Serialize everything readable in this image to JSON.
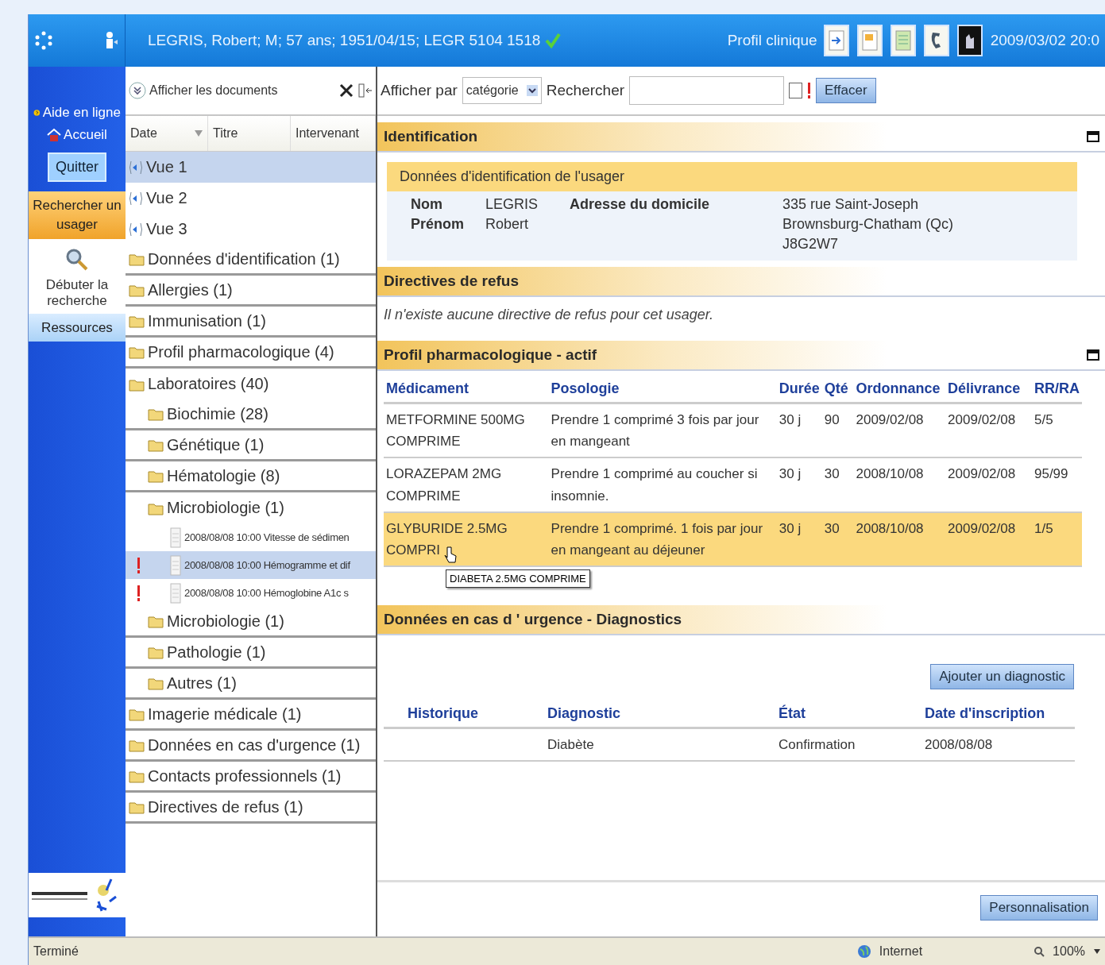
{
  "header": {
    "patient": "LEGRIS, Robert; M; 57 ans; 1951/04/15; LEGR 5104 1518",
    "verified": true,
    "profile_label": "Profil clinique",
    "datetime": "2009/03/02 20:0"
  },
  "nav": {
    "items": [
      {
        "label": "Aide en ligne",
        "kind": "help"
      },
      {
        "label": "Accueil",
        "kind": "home"
      },
      {
        "label": "Quitter",
        "kind": "button"
      },
      {
        "label": "Rechercher un usager",
        "kind": "tab",
        "selected": true
      },
      {
        "label": "Débuter la recherche",
        "kind": "action"
      },
      {
        "label": "Ressources",
        "kind": "tab",
        "selected": false
      }
    ]
  },
  "documents": {
    "toggle_label": "Afficher les documents",
    "columns": [
      "Date",
      "Titre",
      "Intervenant"
    ],
    "tree": [
      {
        "label": "Vue 1",
        "kind": "view",
        "selected": true
      },
      {
        "label": "Vue 2",
        "kind": "view",
        "selected": false
      },
      {
        "label": "Vue 3",
        "kind": "view",
        "selected": false
      },
      {
        "label": "Données d'identification (1)",
        "kind": "folder",
        "selected": false
      },
      {
        "label": "Allergies (1)",
        "kind": "folder",
        "selected": false
      },
      {
        "label": "Immunisation (1)",
        "kind": "folder",
        "selected": false
      },
      {
        "label": "Profil pharmacologique (4)",
        "kind": "folder",
        "selected": false
      },
      {
        "label": "Laboratoires (40)",
        "kind": "folder",
        "selected": false,
        "children": [
          {
            "label": "Biochimie (28)",
            "kind": "folder",
            "selected": false
          },
          {
            "label": "Génétique (1)",
            "kind": "folder",
            "selected": false
          },
          {
            "label": "Hématologie (8)",
            "kind": "folder",
            "selected": false
          },
          {
            "label": "Microbiologie (1)",
            "kind": "folder",
            "selected": false,
            "children": [
              {
                "label": "2008/08/08 10:00 Vitesse de sédimen",
                "kind": "document",
                "selected": false,
                "flagged": false
              },
              {
                "label": "2008/08/08 10:00 Hémogramme et dif",
                "kind": "document",
                "selected": true,
                "flagged": true
              },
              {
                "label": "2008/08/08 10:00 Hémoglobine A1c s",
                "kind": "document",
                "selected": false,
                "flagged": true
              }
            ]
          },
          {
            "label": "Microbiologie (1)",
            "kind": "folder",
            "selected": false
          },
          {
            "label": "Pathologie (1)",
            "kind": "folder",
            "selected": false
          },
          {
            "label": "Autres (1)",
            "kind": "folder",
            "selected": false
          }
        ]
      },
      {
        "label": "Imagerie médicale (1)",
        "kind": "folder",
        "selected": false
      },
      {
        "label": "Données en cas d'urgence (1)",
        "kind": "folder",
        "selected": false
      },
      {
        "label": "Contacts professionnels (1)",
        "kind": "folder",
        "selected": false
      },
      {
        "label": "Directives de refus (1)",
        "kind": "folder",
        "selected": false
      }
    ]
  },
  "filter": {
    "group_label": "Afficher par",
    "group_value": "catégorie",
    "search_label": "Rechercher",
    "flag_checked": false,
    "clear_button": "Effacer"
  },
  "identification": {
    "title": "Identification",
    "collapsible": true,
    "subtitle": "Données d'identification de l'usager",
    "fields": [
      {
        "label": "Nom",
        "value": "LEGRIS"
      },
      {
        "label": "Prénom",
        "value": "Robert"
      }
    ],
    "address_label": "Adresse du domicile",
    "address_lines": [
      "335 rue Saint-Joseph",
      "Brownsburg-Chatham (Qc)",
      "J8G2W7"
    ]
  },
  "refusals": {
    "title": "Directives de refus",
    "collapsible": false,
    "message": "Il n'existe aucune directive de refus pour cet usager."
  },
  "pharmacology": {
    "title": "Profil pharmacologique - actif",
    "collapsible": true,
    "columns": [
      "Médicament",
      "Posologie",
      "Durée",
      "Qté",
      "Ordonnance",
      "Délivrance",
      "RR/RA"
    ],
    "rows": [
      {
        "cells": [
          "METFORMINE 500MG COMPRIME",
          "Prendre 1 comprimé 3 fois par jour en mangeant",
          "30 j",
          "90",
          "2009/02/08",
          "2009/02/08",
          "5/5"
        ],
        "selected": false
      },
      {
        "cells": [
          "LORAZEPAM 2MG COMPRIME",
          "Prendre 1 comprimé au coucher si insomnie.",
          "30 j",
          "30",
          "2008/10/08",
          "2009/02/08",
          "95/99"
        ],
        "selected": false
      },
      {
        "cells": [
          "GLYBURIDE 2.5MG COMPRI",
          "Prendre 1 comprimé. 1 fois par jour en mangeant au déjeuner",
          "30 j",
          "30",
          "2008/10/08",
          "2009/02/08",
          "1/5"
        ],
        "selected": true
      }
    ],
    "tooltip": "DIABETA 2.5MG COMPRIME"
  },
  "emergency": {
    "title": "Données en cas d ' urgence - Diagnostics",
    "collapsible": false,
    "add_button": "Ajouter un diagnostic",
    "columns": [
      "Historique",
      "Diagnostic",
      "État",
      "Date d'inscription"
    ],
    "rows": [
      {
        "diagnosis": "Diabète",
        "state": "Confirmation",
        "date": "2008/08/08"
      }
    ],
    "custom_button": "Personnalisation"
  },
  "status_bar": {
    "status": "Terminé",
    "zone": "Internet",
    "zoom": "100%"
  }
}
